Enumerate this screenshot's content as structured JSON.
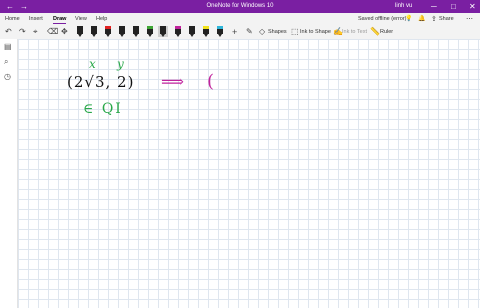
{
  "window": {
    "title": "OneNote for Windows 10",
    "user": "linh vu",
    "back_glyph": "←",
    "forward_glyph": "→",
    "minimize_glyph": "─",
    "maximize_glyph": "□",
    "close_glyph": "✕"
  },
  "ribbon": {
    "tabs": [
      "Home",
      "Insert",
      "Draw",
      "View",
      "Help"
    ],
    "active_tab": "Draw",
    "status": "Saved offline (error)",
    "share_label": "Share",
    "share_glyph": "⇪",
    "bell_glyph": "🔔",
    "lightbulb_glyph": "💡",
    "more_glyph": "⋯"
  },
  "toolbar": {
    "undo_glyph": "↶",
    "redo_glyph": "↷",
    "lasso_glyph": "⌖",
    "eraser_glyph": "⌫",
    "add_space_glyph": "✥",
    "add_pen_glyph": "+",
    "shapes_label": "Shapes",
    "ink_to_shape_label": "Ink to Shape",
    "ink_to_text_label": "Ink to Text",
    "ruler_label": "Ruler",
    "pens": [
      {
        "color": "#222222"
      },
      {
        "color": "#222222"
      },
      {
        "color": "#e02020"
      },
      {
        "color": "#222222"
      },
      {
        "color": "#222222"
      },
      {
        "color": "#3fa635"
      },
      {
        "color": "#222222"
      },
      {
        "color": "#c0239c"
      },
      {
        "color": "#222222"
      },
      {
        "color": "#f2e21a"
      },
      {
        "color": "#2fb5d8"
      },
      {
        "color": "#b0b0b0"
      },
      {
        "color": "#f2e21a"
      }
    ]
  },
  "sidebar": {
    "notebooks_glyph": "▤",
    "search_glyph": "⌕",
    "recent_glyph": "◷"
  },
  "ink": {
    "x_label": "x",
    "y_label": "y",
    "point": "(2√3, 2)",
    "arrow": "⟹",
    "open_paren": "(",
    "quadrant": "∈ QI",
    "colors": {
      "green": "#2aa84a",
      "black": "#111111",
      "magenta": "#c0239c"
    }
  }
}
